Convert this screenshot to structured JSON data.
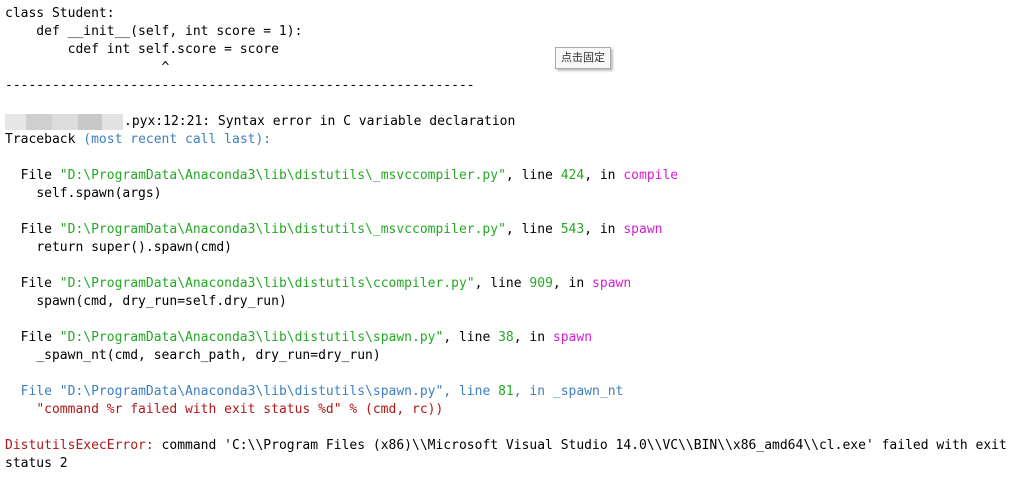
{
  "code": {
    "line1": "class Student:",
    "line2": "    def __init__(self, int score = 1):",
    "line3": "        cdef int self.score = score",
    "line4": "                    ^",
    "separator": "------------------------------------------------------------"
  },
  "error_location": ".pyx:12:21: Syntax error in C variable declaration",
  "traceback_header": {
    "prefix": "Traceback ",
    "hint": "(most recent call last):"
  },
  "frames": [
    {
      "file": "\"D:\\ProgramData\\Anaconda3\\lib\\distutils\\_msvccompiler.py\"",
      "line": "424",
      "func": "compile",
      "code": "self.spawn(args)"
    },
    {
      "file": "\"D:\\ProgramData\\Anaconda3\\lib\\distutils\\_msvccompiler.py\"",
      "line": "543",
      "func": "spawn",
      "code": "return super().spawn(cmd)"
    },
    {
      "file": "\"D:\\ProgramData\\Anaconda3\\lib\\distutils\\ccompiler.py\"",
      "line": "909",
      "func": "spawn",
      "code": "spawn(cmd, dry_run=self.dry_run)"
    },
    {
      "file": "\"D:\\ProgramData\\Anaconda3\\lib\\distutils\\spawn.py\"",
      "line": "38",
      "func": "spawn",
      "code": "_spawn_nt(cmd, search_path, dry_run=dry_run)"
    },
    {
      "file": "\"D:\\ProgramData\\Anaconda3\\lib\\distutils\\spawn.py\"",
      "line": "81",
      "func": "_spawn_nt",
      "code": "\"command %r failed with exit status %d\" % (cmd, rc))"
    }
  ],
  "labels": {
    "file": "File ",
    "line": ", line ",
    "in": ", in "
  },
  "final_error": {
    "type": "DistutilsExecError:",
    "message": " command 'C:\\\\Program Files (x86)\\\\Microsoft Visual Studio 14.0\\\\VC\\\\BIN\\\\x86_amd64\\\\cl.exe' failed with exit",
    "message2": "status 2"
  },
  "tooltip": "点击固定"
}
